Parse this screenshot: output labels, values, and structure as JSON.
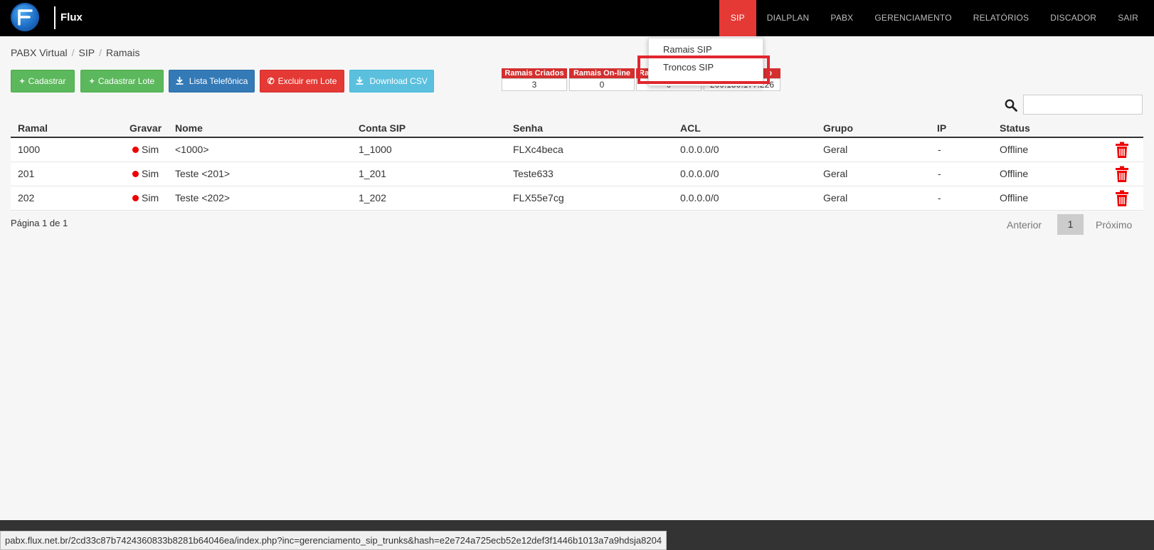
{
  "brand": {
    "name": "Flux"
  },
  "nav": {
    "items": [
      "SIP",
      "DIALPLAN",
      "PABX",
      "GERENCIAMENTO",
      "RELATÓRIOS",
      "DISCADOR",
      "SAIR"
    ],
    "active": "SIP"
  },
  "breadcrumb": [
    "PABX Virtual",
    "SIP",
    "Ramais"
  ],
  "breadcrumb_sep": "/",
  "buttons": {
    "cadastrar": "Cadastrar",
    "cadastrar_lote": "Cadastrar Lote",
    "lista_telefonica": "Lista Telefônica",
    "excluir_lote": "Excluir em Lote",
    "download_csv": "Download CSV"
  },
  "stats": [
    {
      "label": "Ramais Criados",
      "value": "3"
    },
    {
      "label": "Ramais On-line",
      "value": "0"
    },
    {
      "label": "Ra",
      "value": "0"
    },
    {
      "label": "o",
      "value": "200.150.177.226"
    }
  ],
  "dropdown": {
    "items": [
      "Ramais SIP",
      "Troncos SIP"
    ],
    "highlighted": "Troncos SIP"
  },
  "table": {
    "headers": [
      "Ramal",
      "Gravar",
      "Nome",
      "Conta SIP",
      "Senha",
      "ACL",
      "Grupo",
      "IP",
      "Status"
    ],
    "rows": [
      {
        "ramal": "1000",
        "gravar": "Sim",
        "nome": "<1000>",
        "conta": "1_1000",
        "senha": "FLXc4beca",
        "acl": "0.0.0.0/0",
        "grupo": "Geral",
        "ip": "-",
        "status": "Offline"
      },
      {
        "ramal": "201",
        "gravar": "Sim",
        "nome": "Teste <201>",
        "conta": "1_201",
        "senha": "Teste633",
        "acl": "0.0.0.0/0",
        "grupo": "Geral",
        "ip": "-",
        "status": "Offline"
      },
      {
        "ramal": "202",
        "gravar": "Sim",
        "nome": "Teste <202>",
        "conta": "1_202",
        "senha": "FLX55e7cg",
        "acl": "0.0.0.0/0",
        "grupo": "Geral",
        "ip": "-",
        "status": "Offline"
      }
    ]
  },
  "pagination": {
    "info": "Página 1 de 1",
    "prev": "Anterior",
    "current": "1",
    "next": "Próximo"
  },
  "status_url": "pabx.flux.net.br/2cd33c87b7424360833b8281b64046ea/index.php?inc=gerenciamento_sip_trunks&hash=e2e724a725ecb52e12def3f1446b1013a7a9hdsja8204",
  "colors": {
    "accent_red": "#e53935",
    "green": "#5cb85c",
    "blue": "#337ab7",
    "cyan": "#5bc0de"
  }
}
